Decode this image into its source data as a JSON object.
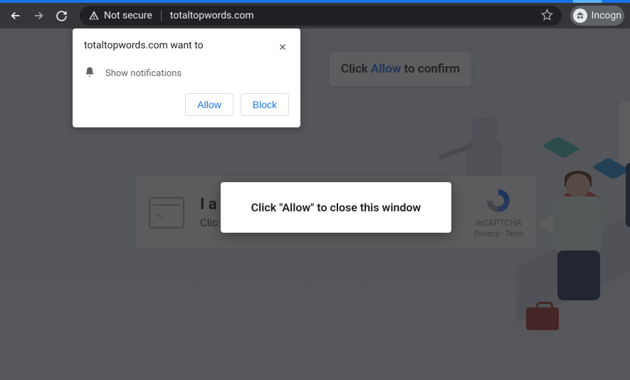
{
  "toolbar": {
    "not_secure_label": "Not secure",
    "url": "totaltopwords.com",
    "incognito_label": "Incogn"
  },
  "perm_popup": {
    "title": "totaltopwords.com want to",
    "option_label": "Show notifications",
    "allow_label": "Allow",
    "block_label": "Block"
  },
  "tooltip": {
    "prefix": "Click ",
    "highlight": "Allow",
    "suffix": " to confirm"
  },
  "recaptcha": {
    "line1": "I a",
    "line2": "Clic",
    "brand": "reCAPTCHA",
    "links": "Privacy - Term"
  },
  "center_popup": {
    "text": "Click \"Allow\" to close this window"
  }
}
